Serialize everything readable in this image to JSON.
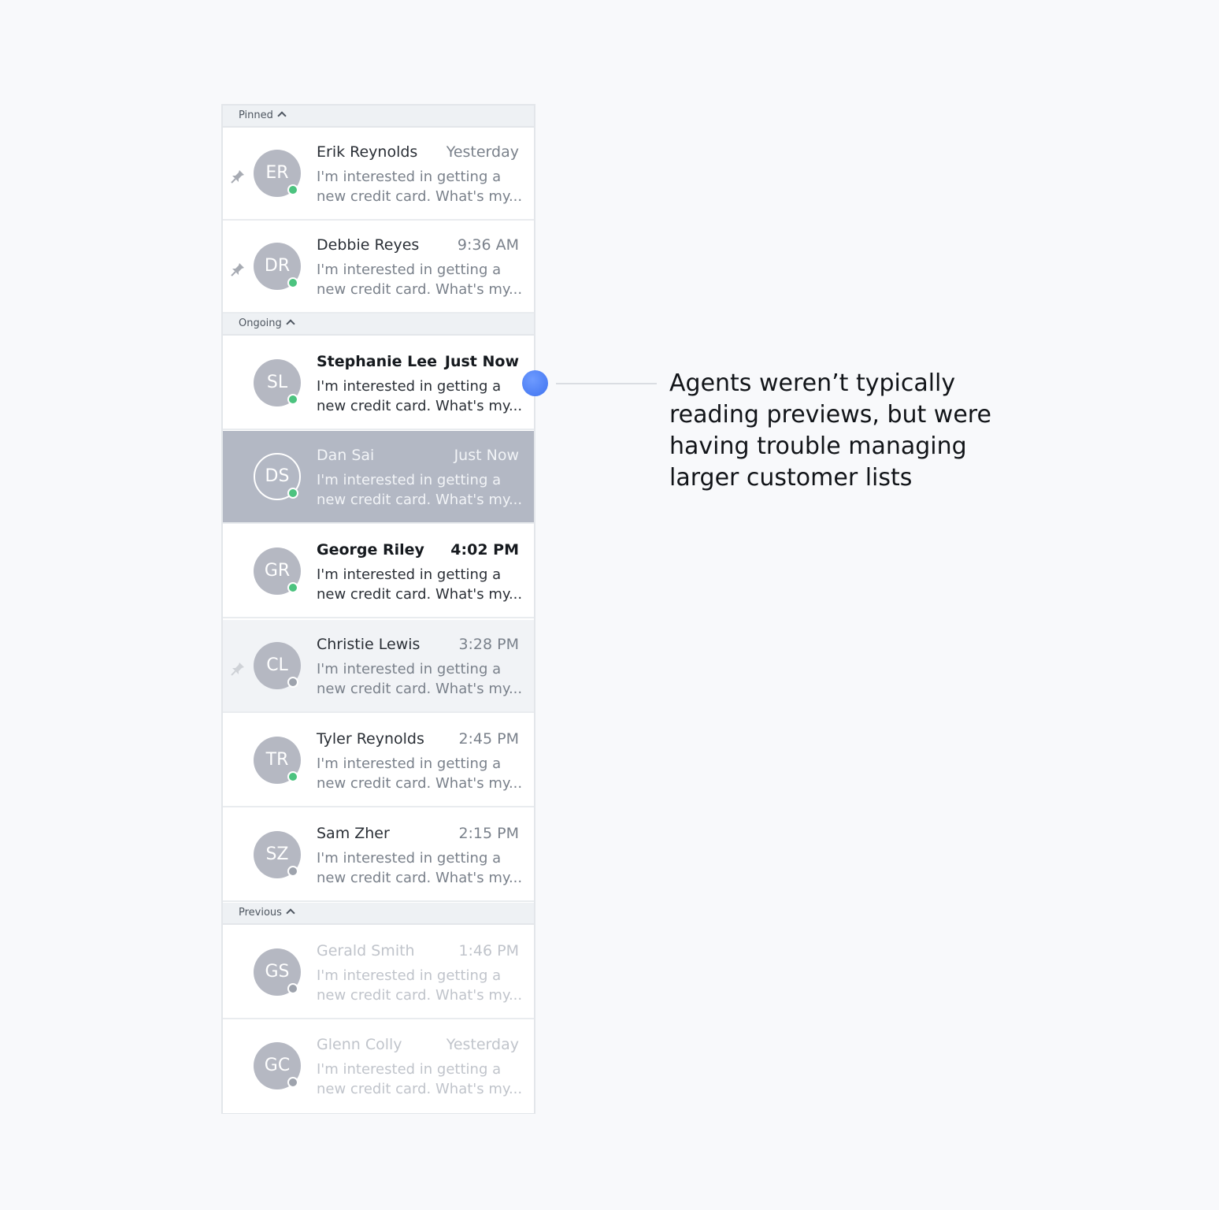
{
  "sections": {
    "pinned": "Pinned",
    "ongoing": "Ongoing",
    "previous": "Previous"
  },
  "conversations": [
    {
      "initials": "ER",
      "name": "Erik Reynolds",
      "time": "Yesterday",
      "preview_line1": "I'm interested in getting a",
      "preview_line2": "new credit card. What's my...",
      "status": "online",
      "pinned": true
    },
    {
      "initials": "DR",
      "name": "Debbie Reyes",
      "time": "9:36 AM",
      "preview_line1": "I'm interested in getting a",
      "preview_line2": "new credit card. What's my...",
      "status": "online",
      "pinned": true
    },
    {
      "initials": "SL",
      "name": "Stephanie Lee",
      "time": "Just Now",
      "preview_line1": "I'm interested in getting a",
      "preview_line2": "new credit card. What's my...",
      "status": "online",
      "unread": true
    },
    {
      "initials": "DS",
      "name": "Dan Sai",
      "time": "Just Now",
      "preview_line1": "I'm interested in getting a",
      "preview_line2": "new credit card. What's my...",
      "status": "online",
      "selected": true
    },
    {
      "initials": "GR",
      "name": "George Riley",
      "time": "4:02 PM",
      "preview_line1": "I'm interested in getting a",
      "preview_line2": "new credit card. What's my...",
      "status": "online",
      "unread": true
    },
    {
      "initials": "CL",
      "name": "Christie Lewis",
      "time": "3:28 PM",
      "preview_line1": "I'm interested in getting a",
      "preview_line2": "new credit card. What's my...",
      "status": "offline",
      "hover": true
    },
    {
      "initials": "TR",
      "name": "Tyler Reynolds",
      "time": "2:45 PM",
      "preview_line1": "I'm interested in getting a",
      "preview_line2": "new credit card. What's my...",
      "status": "online"
    },
    {
      "initials": "SZ",
      "name": "Sam Zher",
      "time": "2:15 PM",
      "preview_line1": "I'm interested in getting a",
      "preview_line2": "new credit card. What's my...",
      "status": "offline"
    },
    {
      "initials": "GS",
      "name": "Gerald Smith",
      "time": "1:46 PM",
      "preview_line1": "I'm interested in getting a",
      "preview_line2": "new credit card. What's my...",
      "status": "offline",
      "previous": true
    },
    {
      "initials": "GC",
      "name": "Glenn Colly",
      "time": "Yesterday",
      "preview_line1": "I'm interested in getting a",
      "preview_line2": "new credit card. What's my...",
      "status": "offline",
      "previous": true
    }
  ],
  "annotation": {
    "text": "Agents weren’t typically\nreading previews, but were\nhaving trouble managing\nlarger customer lists"
  },
  "colors": {
    "online": "#4cc37f",
    "offline": "#9ea3ad",
    "selected_row": "#b3b8c4",
    "accent_dot": "#3f73f0"
  }
}
